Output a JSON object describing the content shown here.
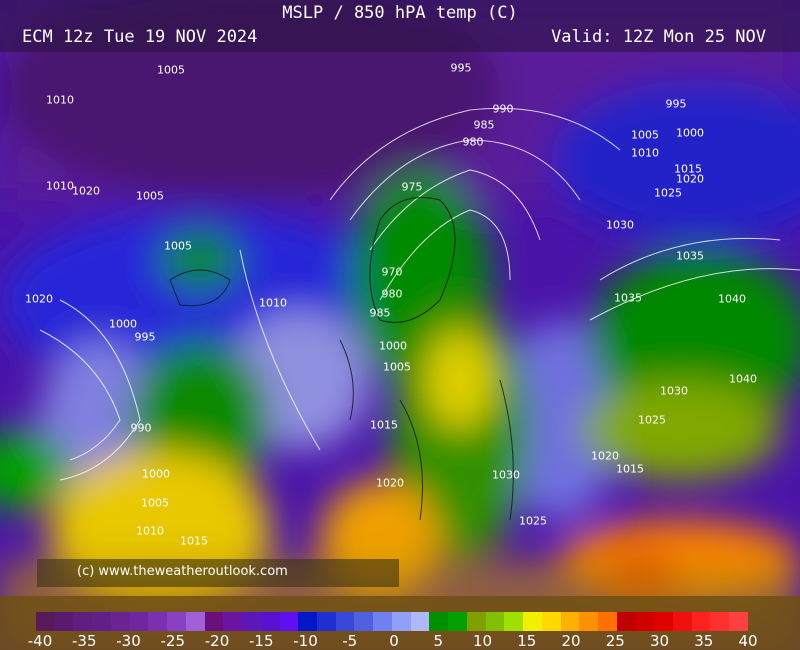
{
  "header": {
    "title": "MSLP / 850 hPA temp (C)",
    "run": "ECM 12z Tue 19 NOV 2024",
    "valid": "Valid: 12Z Mon 25 NOV"
  },
  "copyright": "(c) www.theweatheroutlook.com",
  "legend": {
    "ticks": [
      "-40",
      "-35",
      "-30",
      "-25",
      "-20",
      "-15",
      "-10",
      "-5",
      "0",
      "5",
      "10",
      "15",
      "20",
      "25",
      "30",
      "35",
      "40"
    ],
    "colors": [
      "#5a1a5a",
      "#5c1a6e",
      "#601c7e",
      "#641e88",
      "#6a2294",
      "#70269e",
      "#7a30b0",
      "#8a40c4",
      "#a060d8",
      "#6a107a",
      "#6c14a0",
      "#5a18b8",
      "#5a10d0",
      "#6010f0",
      "#0018c8",
      "#2030d0",
      "#3848d8",
      "#5060e0",
      "#7080f0",
      "#90a0f8",
      "#b0b8f8",
      "#009000",
      "#00a000",
      "#80a000",
      "#80c000",
      "#a0e000",
      "#f0f000",
      "#ffd800",
      "#ffb000",
      "#ff9000",
      "#ff7000",
      "#c00000",
      "#d00000",
      "#e00000",
      "#f01010",
      "#ff2020",
      "#ff3030",
      "#ff4040"
    ]
  },
  "isobars": [
    "1005",
    "1010",
    "995",
    "990",
    "985",
    "980",
    "975",
    "970",
    "980",
    "985",
    "1000",
    "1005",
    "1010",
    "1015",
    "1020",
    "1005",
    "1005",
    "1000",
    "995",
    "990",
    "1000",
    "1005",
    "1010",
    "1015",
    "1020",
    "995",
    "1000",
    "1005",
    "1010",
    "1015",
    "1020",
    "1025",
    "1030",
    "1035",
    "1040",
    "1035",
    "1030",
    "1025",
    "1040",
    "1020",
    "1015",
    "1025",
    "1030",
    "1010",
    "1020"
  ]
}
